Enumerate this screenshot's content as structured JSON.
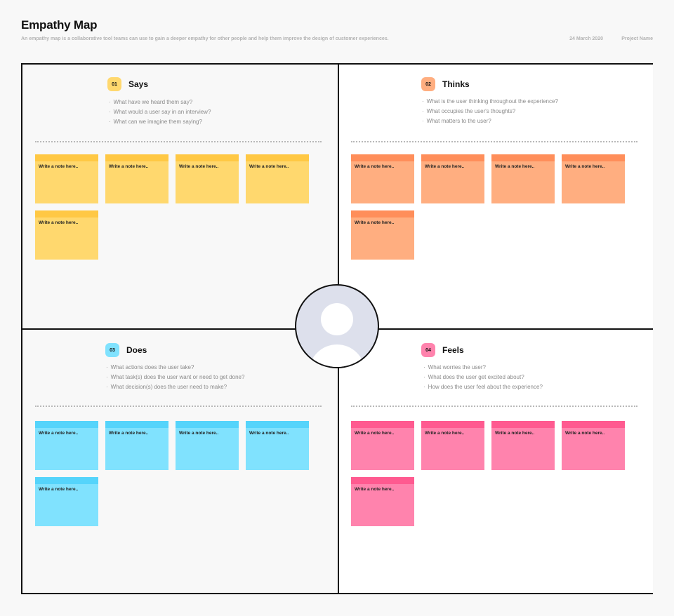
{
  "header": {
    "title": "Empathy Map",
    "subtitle": "An empathy map is a collaborative tool teams can use to gain a deeper empathy for other people and help them improve the design of customer experiences.",
    "date": "24 March 2020",
    "project": "Project Name"
  },
  "quadrants": {
    "says": {
      "number": "01",
      "title": "Says",
      "color": "#ffd86e",
      "top_color": "#ffc844",
      "questions": [
        "What have we heard them say?",
        "What would a user say in an interview?",
        "What can we imagine them saying?"
      ],
      "notes": [
        "Write a note here..",
        "Write a note here..",
        "Write a note here..",
        "Write a note here..",
        "Write a note here.."
      ]
    },
    "thinks": {
      "number": "02",
      "title": "Thinks",
      "color": "#ffae80",
      "top_color": "#ff8e5a",
      "questions": [
        "What is the user thinking throughout the experience?",
        "What occupies the user's thoughts?",
        "What matters to the user?"
      ],
      "notes": [
        "Write a note here..",
        "Write a note here..",
        "Write a note here..",
        "Write a note here..",
        "Write a note here.."
      ]
    },
    "does": {
      "number": "03",
      "title": "Does",
      "color": "#80e2fe",
      "top_color": "#55d4fb",
      "questions": [
        "What actions does the user take?",
        "What task(s) does the user want or need to get done?",
        "What decision(s) does the user need to make?"
      ],
      "notes": [
        "Write a note here..",
        "Write a note here..",
        "Write a note here..",
        "Write a note here..",
        "Write a note here.."
      ]
    },
    "feels": {
      "number": "04",
      "title": "Feels",
      "color": "#ff83ad",
      "top_color": "#ff5a90",
      "questions": [
        "What worries the user?",
        "What does the user get excited about?",
        "How does the user feel about the experience?"
      ],
      "notes": [
        "Write a note here..",
        "Write a note here..",
        "Write a note here..",
        "Write a note here..",
        "Write a note here.."
      ]
    }
  },
  "avatar": {
    "icon": "user-avatar-icon"
  }
}
